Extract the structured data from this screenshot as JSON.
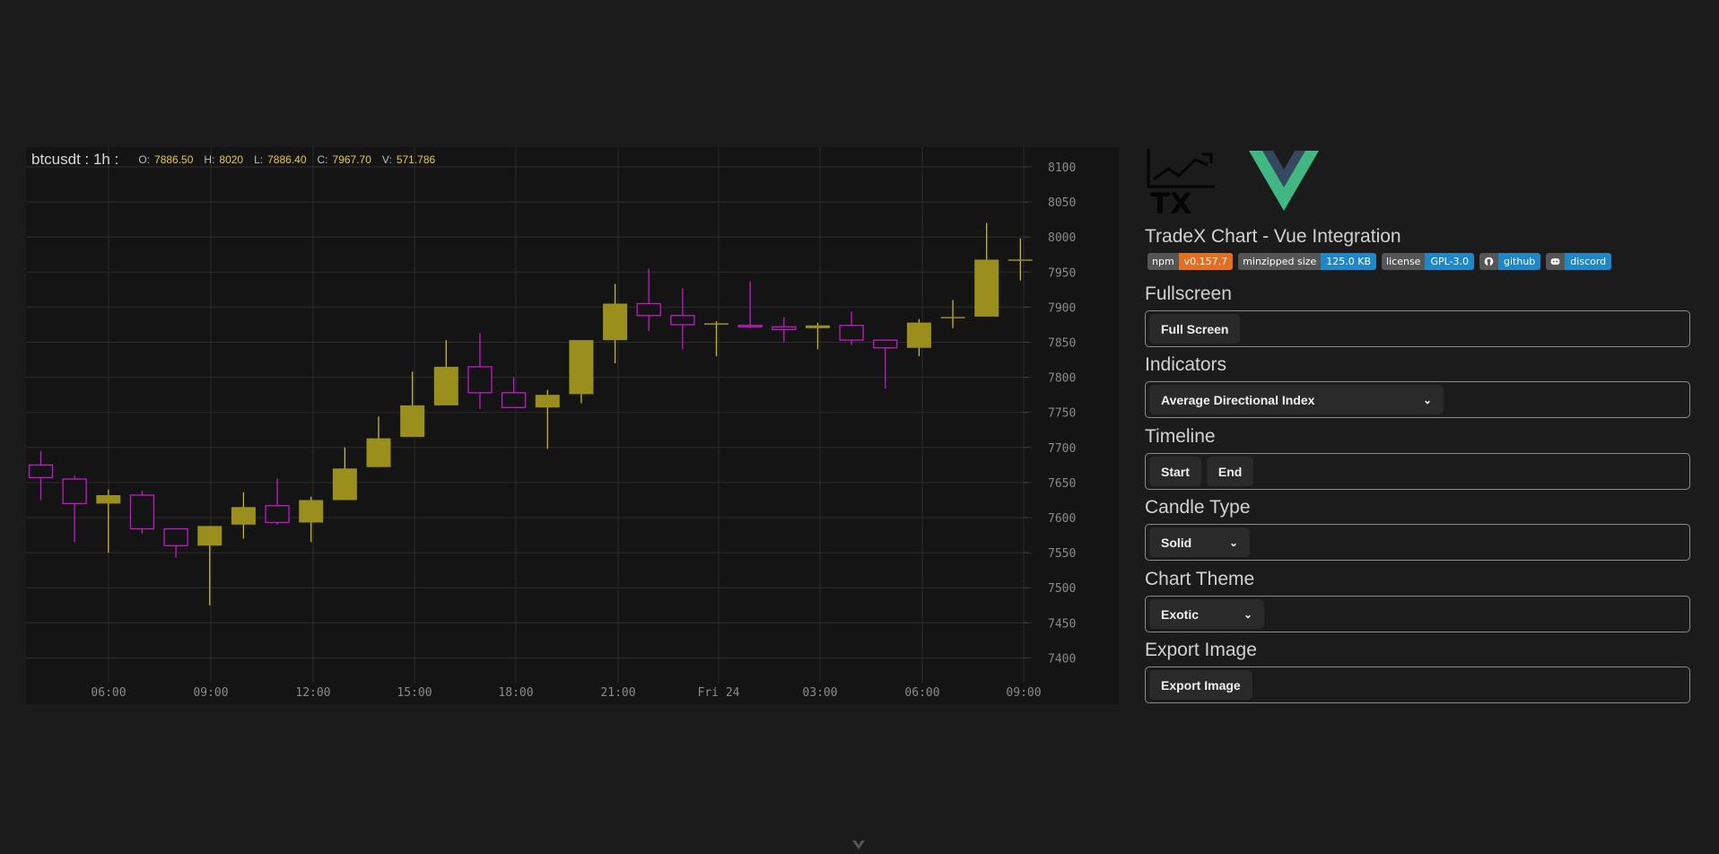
{
  "chart": {
    "symbol": "btcusdt : 1h :",
    "legend": [
      {
        "k": "O:",
        "v": "7886.50"
      },
      {
        "k": "H:",
        "v": "8020"
      },
      {
        "k": "L:",
        "v": "7886.40"
      },
      {
        "k": "C:",
        "v": "7967.70"
      },
      {
        "k": "V:",
        "v": "571.786"
      }
    ]
  },
  "chart_data": {
    "type": "candlestick",
    "y_ticks": [
      "8100",
      "8050",
      "8000",
      "7950",
      "7900",
      "7850",
      "7800",
      "7750",
      "7700",
      "7650",
      "7600",
      "7550",
      "7500",
      "7450",
      "7400"
    ],
    "x_ticks": [
      "06:00",
      "09:00",
      "12:00",
      "15:00",
      "18:00",
      "21:00",
      "Fri 24",
      "03:00",
      "06:00",
      "09:00"
    ],
    "ylim": [
      7375,
      8128
    ],
    "grid": true,
    "colors": {
      "up": "#9a8f1d",
      "up_wick": "#c9b830",
      "down": "#c21ac8"
    },
    "candles": [
      {
        "o": 7675,
        "h": 7695,
        "l": 7625,
        "c": 7657
      },
      {
        "o": 7655,
        "h": 7660,
        "l": 7565,
        "c": 7620
      },
      {
        "o": 7620,
        "h": 7640,
        "l": 7550,
        "c": 7632
      },
      {
        "o": 7632,
        "h": 7638,
        "l": 7577,
        "c": 7584
      },
      {
        "o": 7584,
        "h": 7584,
        "l": 7543,
        "c": 7560
      },
      {
        "o": 7560,
        "h": 7588,
        "l": 7475,
        "c": 7588
      },
      {
        "o": 7590,
        "h": 7636,
        "l": 7570,
        "c": 7615
      },
      {
        "o": 7617,
        "h": 7656,
        "l": 7590,
        "c": 7593
      },
      {
        "o": 7593,
        "h": 7630,
        "l": 7565,
        "c": 7625
      },
      {
        "o": 7625,
        "h": 7700,
        "l": 7625,
        "c": 7670
      },
      {
        "o": 7672,
        "h": 7744,
        "l": 7672,
        "c": 7713
      },
      {
        "o": 7715,
        "h": 7808,
        "l": 7715,
        "c": 7760
      },
      {
        "o": 7760,
        "h": 7853,
        "l": 7760,
        "c": 7815
      },
      {
        "o": 7815,
        "h": 7863,
        "l": 7755,
        "c": 7778
      },
      {
        "o": 7778,
        "h": 7800,
        "l": 7757,
        "c": 7757
      },
      {
        "o": 7757,
        "h": 7782,
        "l": 7698,
        "c": 7775
      },
      {
        "o": 7776,
        "h": 7853,
        "l": 7763,
        "c": 7853
      },
      {
        "o": 7853,
        "h": 7933,
        "l": 7820,
        "c": 7905
      },
      {
        "o": 7905,
        "h": 7955,
        "l": 7866,
        "c": 7888
      },
      {
        "o": 7888,
        "h": 7927,
        "l": 7840,
        "c": 7875
      },
      {
        "o": 7875,
        "h": 7880,
        "l": 7830,
        "c": 7877
      },
      {
        "o": 7874,
        "h": 7937,
        "l": 7870,
        "c": 7872
      },
      {
        "o": 7872,
        "h": 7886,
        "l": 7850,
        "c": 7868
      },
      {
        "o": 7870,
        "h": 7878,
        "l": 7840,
        "c": 7874
      },
      {
        "o": 7874,
        "h": 7894,
        "l": 7846,
        "c": 7853
      },
      {
        "o": 7853,
        "h": 7853,
        "l": 7784,
        "c": 7842
      },
      {
        "o": 7842,
        "h": 7883,
        "l": 7830,
        "c": 7878
      },
      {
        "o": 7886,
        "h": 7910,
        "l": 7870,
        "c": 7886
      },
      {
        "o": 7886.5,
        "h": 8020,
        "l": 7886.4,
        "c": 7967.7
      },
      {
        "o": 7968,
        "h": 7998,
        "l": 7938,
        "c": 7968
      }
    ]
  },
  "panel": {
    "app_logo_text": "TX",
    "title": "TradeX Chart - Vue Integration",
    "badges": [
      {
        "label": "npm",
        "value": "v0.157.7",
        "color": "#e37022",
        "icon": ""
      },
      {
        "label": "minzipped size",
        "value": "125.0 KB",
        "color": "#1f86c7",
        "icon": ""
      },
      {
        "label": "license",
        "value": "GPL-3.0",
        "color": "#1f86c7",
        "icon": ""
      },
      {
        "label": "",
        "value": "github",
        "color": "#1f86c7",
        "icon": "github-icon"
      },
      {
        "label": "",
        "value": "discord",
        "color": "#1f86c7",
        "icon": "discord-icon"
      }
    ],
    "fullscreen": {
      "heading": "Fullscreen",
      "button": "Full Screen"
    },
    "indicators": {
      "heading": "Indicators",
      "selected": "Average Directional Index"
    },
    "timeline": {
      "heading": "Timeline",
      "start": "Start",
      "end": "End"
    },
    "candle_type": {
      "heading": "Candle Type",
      "selected": "Solid"
    },
    "chart_theme": {
      "heading": "Chart Theme",
      "selected": "Exotic"
    },
    "export_image": {
      "heading": "Export Image",
      "button": "Export Image"
    }
  }
}
